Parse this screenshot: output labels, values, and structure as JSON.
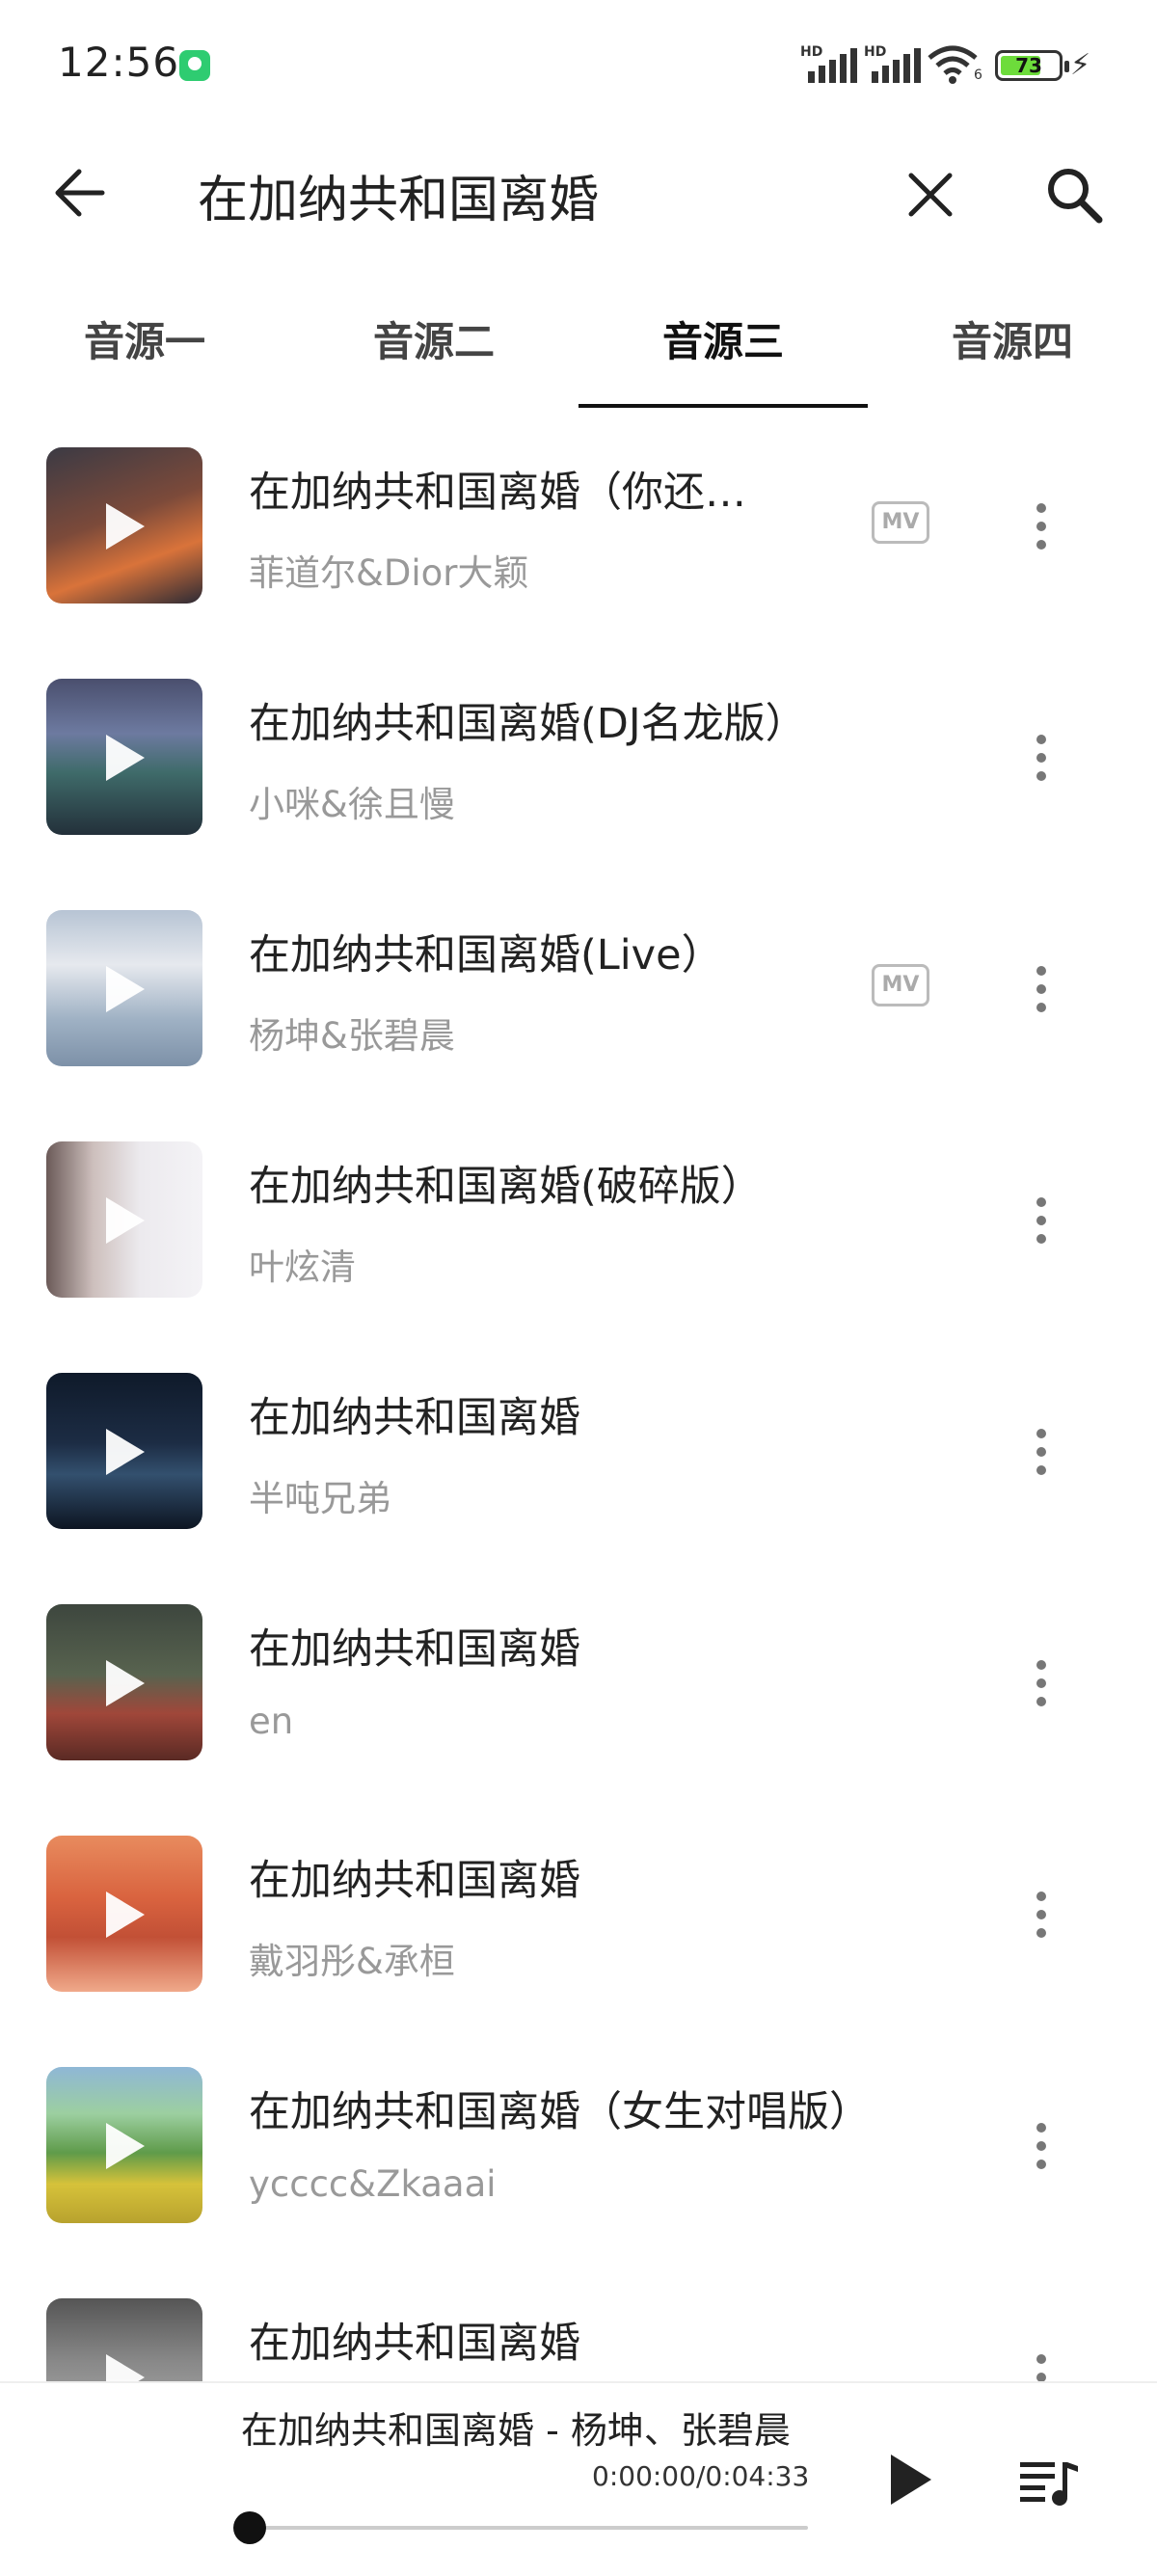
{
  "status_bar": {
    "time": "12:56",
    "signal_label_1": "HD",
    "signal_label_2": "HD",
    "wifi_label": "6",
    "battery": "73",
    "battery_level": 0.73,
    "icons": [
      "app-notification-icon",
      "signal-icon",
      "signal-icon",
      "wifi-icon",
      "battery-icon",
      "charging-icon"
    ]
  },
  "search": {
    "query": "在加纳共和国离婚",
    "icons": [
      "back-arrow-icon",
      "close-icon",
      "search-icon"
    ]
  },
  "tabs": [
    {
      "label": "音源一"
    },
    {
      "label": "音源二"
    },
    {
      "label": "音源三",
      "active": true
    },
    {
      "label": "音源四"
    }
  ],
  "results": [
    {
      "title": "在加纳共和国离婚（你还…",
      "artist": "菲道尔&Dior大颖",
      "mv": "MV"
    },
    {
      "title": "在加纳共和国离婚(DJ名龙版）",
      "artist": "小咪&徐且慢"
    },
    {
      "title": "在加纳共和国离婚(Live）",
      "artist": "杨坤&张碧晨",
      "mv": "MV"
    },
    {
      "title": "在加纳共和国离婚(破碎版）",
      "artist": "叶炫清"
    },
    {
      "title": "在加纳共和国离婚",
      "artist": "半吨兄弟"
    },
    {
      "title": "在加纳共和国离婚",
      "artist": "en"
    },
    {
      "title": "在加纳共和国离婚",
      "artist": "戴羽彤&承桓"
    },
    {
      "title": "在加纳共和国离婚（女生对唱版）",
      "artist": "ycccc&Zkaaai"
    },
    {
      "title": "在加纳共和国离婚",
      "artist": ""
    }
  ],
  "player": {
    "now_playing": "在加纳共和国离婚 - 杨坤、张碧晨",
    "time": "0:00:00/0:04:33",
    "progress": 0,
    "icons": [
      "play-icon",
      "playlist-icon"
    ]
  },
  "colors": {
    "accent": "#111111",
    "secondary_text": "#999999",
    "battery_fill": "#6ddc3b"
  }
}
